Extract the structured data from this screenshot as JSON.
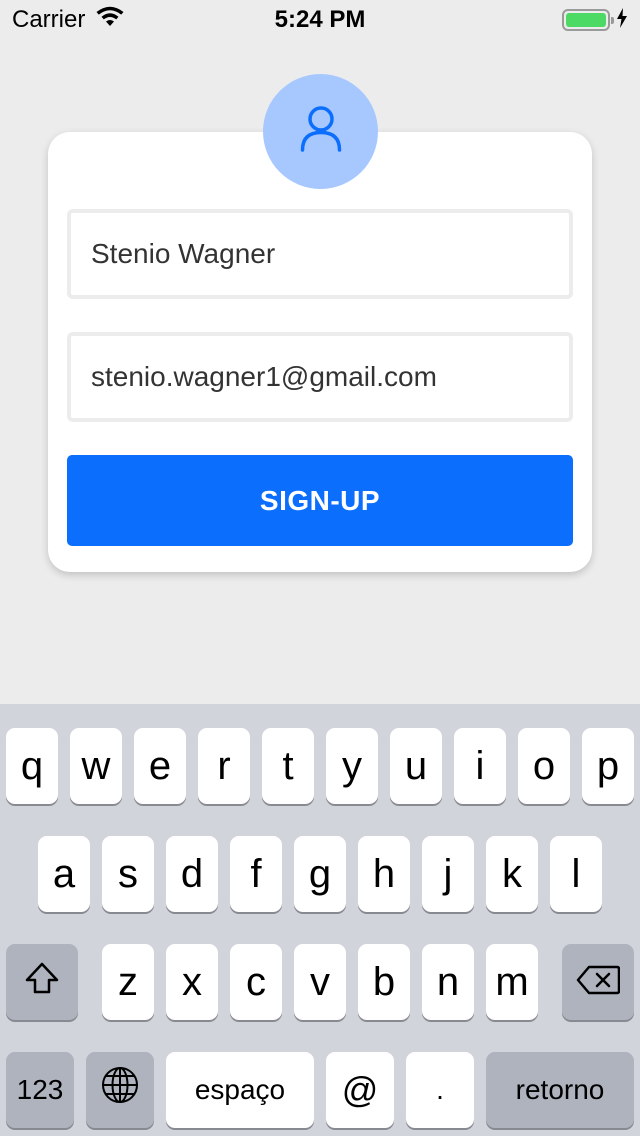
{
  "status_bar": {
    "carrier": "Carrier",
    "time": "5:24 PM"
  },
  "form": {
    "name_value": "Stenio Wagner",
    "email_value": "stenio.wagner1@gmail.com",
    "signup_label": "SIGN-UP"
  },
  "colors": {
    "accent": "#0c6efd",
    "avatar_bg": "#a7c8ff",
    "battery": "#4cd964"
  },
  "keyboard": {
    "row1": [
      "q",
      "w",
      "e",
      "r",
      "t",
      "y",
      "u",
      "i",
      "o",
      "p"
    ],
    "row2": [
      "a",
      "s",
      "d",
      "f",
      "g",
      "h",
      "j",
      "k",
      "l"
    ],
    "row3": [
      "z",
      "x",
      "c",
      "v",
      "b",
      "n",
      "m"
    ],
    "numbers_label": "123",
    "space_label": "espaço",
    "at_label": "@",
    "dot_label": ".",
    "return_label": "retorno",
    "icons": [
      "shift-icon",
      "delete-icon",
      "globe-icon"
    ]
  }
}
